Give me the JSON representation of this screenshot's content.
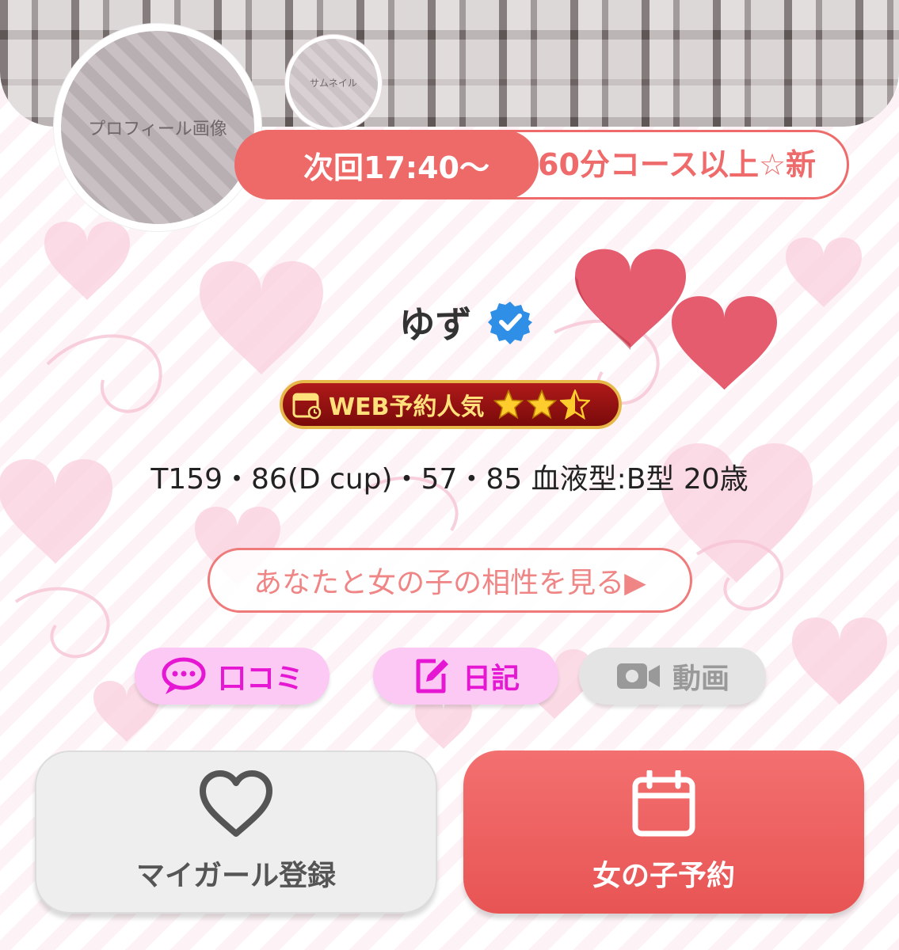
{
  "next_time": "次回17:40〜",
  "ticker_text": "60分コース以上☆新",
  "avatar_placeholder": "プロフィール画像",
  "thumb_placeholder": "サムネイル",
  "name": "ゆず",
  "popularity_badge": "WEB予約人気",
  "popularity_rating": 2.5,
  "stats": "T159・86(D cup)・57・85 血液型:B型 20歳",
  "compatibility_link": "あなたと女の子の相性を見る▶",
  "tabs": [
    {
      "label": "口コミ",
      "active": true
    },
    {
      "label": "日記",
      "active": true
    },
    {
      "label": "動画",
      "active": false
    }
  ],
  "favorite_button": "マイガール登録",
  "reserve_button": "女の子予約",
  "colors": {
    "accent": "#ee6a69",
    "pink_tab": "#fcc8f4",
    "magenta": "#e617d2"
  }
}
